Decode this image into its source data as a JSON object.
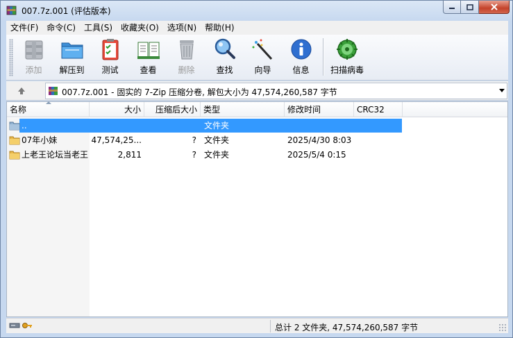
{
  "window": {
    "title": "007.7z.001 (评估版本)",
    "icon": "winrar-archive-icon"
  },
  "menu": [
    "文件(F)",
    "命令(C)",
    "工具(S)",
    "收藏夹(O)",
    "选项(N)",
    "帮助(H)"
  ],
  "toolbar": [
    {
      "label": "添加",
      "icon": "add-archive-icon",
      "disabled": true
    },
    {
      "label": "解压到",
      "icon": "extract-folder-icon",
      "disabled": false
    },
    {
      "label": "测试",
      "icon": "test-checklist-icon",
      "disabled": false
    },
    {
      "label": "查看",
      "icon": "view-book-icon",
      "disabled": false
    },
    {
      "label": "删除",
      "icon": "trash-bin-icon",
      "disabled": true
    },
    {
      "label": "查找",
      "icon": "magnifier-icon",
      "disabled": false
    },
    {
      "label": "向导",
      "icon": "wizard-wand-icon",
      "disabled": false
    },
    {
      "label": "信息",
      "icon": "info-icon",
      "disabled": false
    },
    {
      "label": "扫描病毒",
      "icon": "virus-scan-icon",
      "disabled": false
    }
  ],
  "address": {
    "text": "007.7z.001 - 固实的 7-Zip 压缩分卷, 解包大小为 47,574,260,587 字节"
  },
  "columns": {
    "name": "名称",
    "size": "大小",
    "packed": "压缩后大小",
    "type": "类型",
    "modified": "修改时间",
    "crc": "CRC32"
  },
  "files": [
    {
      "name": "..",
      "size": "",
      "packed": "",
      "type": "文件夹",
      "modified": "",
      "crc": "",
      "selected": true,
      "icon": "parent-folder-icon"
    },
    {
      "name": "07年小妹",
      "size": "47,574,25...",
      "packed": "?",
      "type": "文件夹",
      "modified": "2025/4/30 8:03",
      "crc": "",
      "selected": false,
      "icon": "folder-icon"
    },
    {
      "name": "上老王论坛当老王",
      "size": "2,811",
      "packed": "?",
      "type": "文件夹",
      "modified": "2025/5/4 0:15",
      "crc": "",
      "selected": false,
      "icon": "folder-icon"
    }
  ],
  "status": {
    "summary": "总计 2 文件夹, 47,574,260,587 字节"
  },
  "colors": {
    "selection": "#3399ff",
    "close_button": "#c4432b"
  }
}
